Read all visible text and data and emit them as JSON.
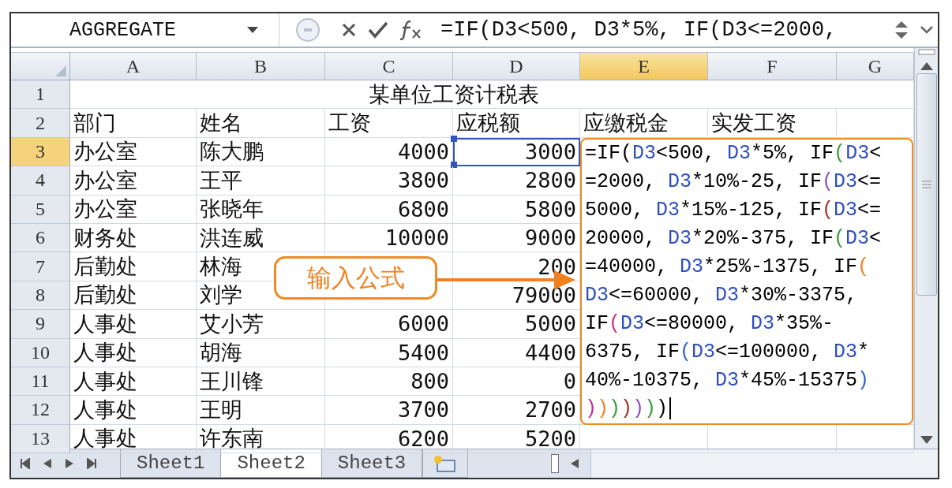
{
  "name_box": "AGGREGATE",
  "formula_bar": "=IF(D3<500, D3*5%, IF(D3<=2000,",
  "column_headers": [
    {
      "label": "A",
      "selected": false
    },
    {
      "label": "B",
      "selected": false
    },
    {
      "label": "C",
      "selected": false
    },
    {
      "label": "D",
      "selected": false
    },
    {
      "label": "E",
      "selected": true
    },
    {
      "label": "F",
      "selected": false
    },
    {
      "label": "G",
      "selected": false
    }
  ],
  "title_row": {
    "number": "1",
    "title": "某单位工资计税表"
  },
  "header_row": {
    "number": "2",
    "cells": [
      "部门",
      "姓名",
      "工资",
      "应税额",
      "应缴税金",
      "实发工资"
    ]
  },
  "rows": [
    {
      "number": "3",
      "selected": true,
      "dept": "办公室",
      "name": "陈大鹏",
      "salary": "4000",
      "taxable": "3000"
    },
    {
      "number": "4",
      "selected": false,
      "dept": "办公室",
      "name": "王平",
      "salary": "3800",
      "taxable": "2800"
    },
    {
      "number": "5",
      "selected": false,
      "dept": "办公室",
      "name": "张晓年",
      "salary": "6800",
      "taxable": "5800"
    },
    {
      "number": "6",
      "selected": false,
      "dept": "财务处",
      "name": "洪连威",
      "salary": "10000",
      "taxable": "9000"
    },
    {
      "number": "7",
      "selected": false,
      "dept": "后勤处",
      "name": "林海",
      "taxable": "200"
    },
    {
      "number": "8",
      "selected": false,
      "dept": "后勤处",
      "name": "刘学",
      "taxable": "79000"
    },
    {
      "number": "9",
      "selected": false,
      "dept": "人事处",
      "name": "艾小芳",
      "salary": "6000",
      "taxable": "5000"
    },
    {
      "number": "10",
      "selected": false,
      "dept": "人事处",
      "name": "胡海",
      "salary": "5400",
      "taxable": "4400"
    },
    {
      "number": "11",
      "selected": false,
      "dept": "人事处",
      "name": "王川锋",
      "salary": "800",
      "taxable": "0"
    },
    {
      "number": "12",
      "selected": false,
      "dept": "人事处",
      "name": "王明",
      "salary": "3700",
      "taxable": "2700"
    },
    {
      "number": "13",
      "selected": false,
      "dept": "人事处",
      "name": "许东南",
      "salary": "6200",
      "taxable": "5200"
    }
  ],
  "formula_editor": [
    [
      {
        "text": "=IF",
        "color": "#000000"
      },
      {
        "text": "(",
        "color": "#000000"
      },
      {
        "text": "D3",
        "color": "#2f4fbf"
      },
      {
        "text": "<500, ",
        "color": "#000000"
      },
      {
        "text": "D3",
        "color": "#2f4fbf"
      },
      {
        "text": "*5%, IF",
        "color": "#000000"
      },
      {
        "text": "(",
        "color": "#3a9a3a"
      },
      {
        "text": "D3",
        "color": "#2f4fbf"
      },
      {
        "text": "<",
        "color": "#000000"
      }
    ],
    [
      {
        "text": "=2000, ",
        "color": "#000000"
      },
      {
        "text": "D3",
        "color": "#2f4fbf"
      },
      {
        "text": "*10%-25, IF",
        "color": "#000000"
      },
      {
        "text": "(",
        "color": "#8a4fc0"
      },
      {
        "text": "D3",
        "color": "#2f4fbf"
      },
      {
        "text": "<=",
        "color": "#000000"
      }
    ],
    [
      {
        "text": "5000, ",
        "color": "#000000"
      },
      {
        "text": "D3",
        "color": "#2f4fbf"
      },
      {
        "text": "*15%-125, IF",
        "color": "#000000"
      },
      {
        "text": "(",
        "color": "#a0302a"
      },
      {
        "text": "D3",
        "color": "#2f4fbf"
      },
      {
        "text": "<=",
        "color": "#000000"
      }
    ],
    [
      {
        "text": "20000, ",
        "color": "#000000"
      },
      {
        "text": "D3",
        "color": "#2f4fbf"
      },
      {
        "text": "*20%-375, IF",
        "color": "#000000"
      },
      {
        "text": "(",
        "color": "#3a9a3a"
      },
      {
        "text": "D3",
        "color": "#2f4fbf"
      },
      {
        "text": "<",
        "color": "#000000"
      }
    ],
    [
      {
        "text": "=40000, ",
        "color": "#000000"
      },
      {
        "text": "D3",
        "color": "#2f4fbf"
      },
      {
        "text": "*25%-1375, IF",
        "color": "#000000"
      },
      {
        "text": "(",
        "color": "#f08020"
      }
    ],
    [
      {
        "text": "D3",
        "color": "#2f4fbf"
      },
      {
        "text": "<=60000, ",
        "color": "#000000"
      },
      {
        "text": "D3",
        "color": "#2f4fbf"
      },
      {
        "text": "*30%-3375,",
        "color": "#000000"
      }
    ],
    [
      {
        "text": "IF",
        "color": "#000000"
      },
      {
        "text": "(",
        "color": "#c0308a"
      },
      {
        "text": "D3",
        "color": "#2f4fbf"
      },
      {
        "text": "<=80000, ",
        "color": "#000000"
      },
      {
        "text": "D3",
        "color": "#2f4fbf"
      },
      {
        "text": "*35%-",
        "color": "#000000"
      }
    ],
    [
      {
        "text": "6375, IF",
        "color": "#000000"
      },
      {
        "text": "(",
        "color": "#3060d0"
      },
      {
        "text": "D3",
        "color": "#2f4fbf"
      },
      {
        "text": "<=100000, ",
        "color": "#000000"
      },
      {
        "text": "D3",
        "color": "#2f4fbf"
      },
      {
        "text": "*",
        "color": "#000000"
      }
    ],
    [
      {
        "text": "40%-10375, ",
        "color": "#000000"
      },
      {
        "text": "D3",
        "color": "#2f4fbf"
      },
      {
        "text": "*45%-15375",
        "color": "#000000"
      },
      {
        "text": ")",
        "color": "#3060d0"
      }
    ],
    [
      {
        "text": ")",
        "color": "#c0308a"
      },
      {
        "text": ")",
        "color": "#f08020"
      },
      {
        "text": ")",
        "color": "#3a9a3a"
      },
      {
        "text": ")",
        "color": "#a0302a"
      },
      {
        "text": ")",
        "color": "#8a4fc0"
      },
      {
        "text": ")",
        "color": "#3a9a3a"
      },
      {
        "text": ")",
        "color": "#000000"
      }
    ]
  ],
  "callout": "输入公式",
  "sheet_tabs": [
    {
      "label": "Sheet1",
      "selected": false
    },
    {
      "label": "Sheet2",
      "selected": true
    },
    {
      "label": "Sheet3",
      "selected": false
    }
  ]
}
